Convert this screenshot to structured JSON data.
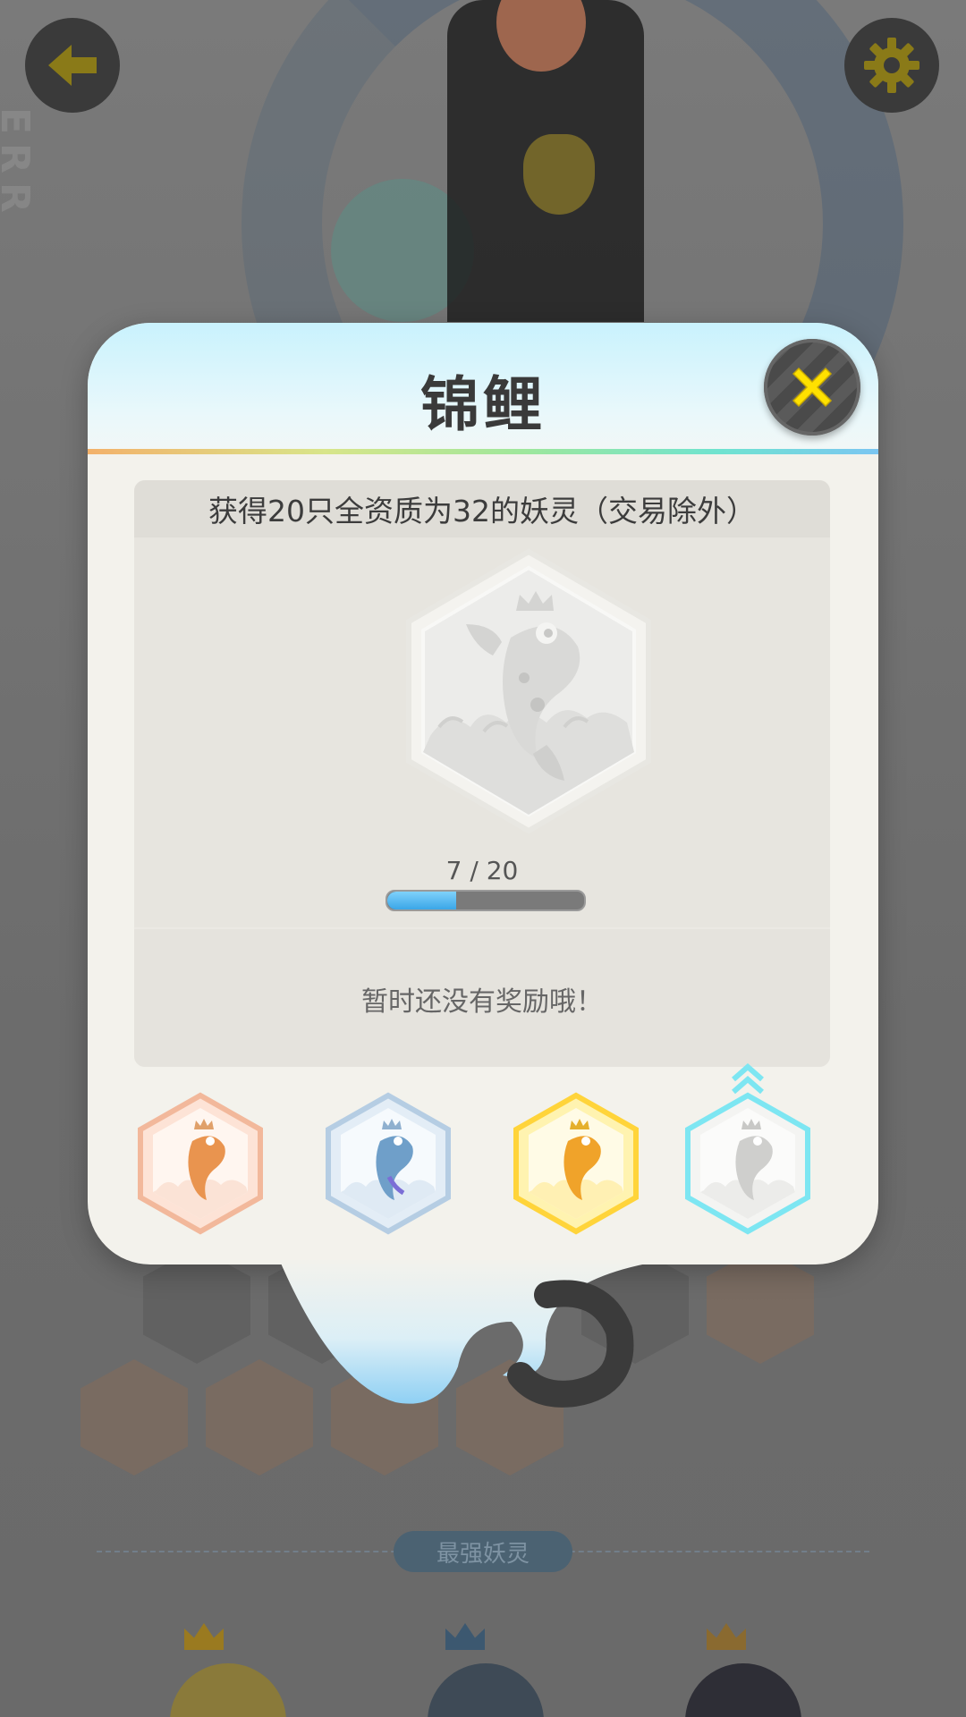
{
  "background": {
    "vertical_text": "ERR",
    "section_label": "最强妖灵"
  },
  "modal": {
    "title": "锦鲤",
    "task_description": "获得20只全资质为32的妖灵（交易除外）",
    "progress": {
      "current": 7,
      "total": 20,
      "text": "7 / 20"
    },
    "reward_text": "暂时还没有奖励哦！",
    "tiers": [
      {
        "name": "bronze",
        "color": "#f2a77f"
      },
      {
        "name": "silver",
        "color": "#9ec3e4"
      },
      {
        "name": "gold",
        "color": "#ffd43a"
      },
      {
        "name": "diamond",
        "color": "#7de6f2",
        "selected": true
      }
    ]
  },
  "colors": {
    "accent_yellow": "#ffe100",
    "progress_blue": "#3aa6e8"
  },
  "icons": {
    "back": "arrow-left-icon",
    "settings": "gear-icon",
    "close": "close-x-icon"
  }
}
